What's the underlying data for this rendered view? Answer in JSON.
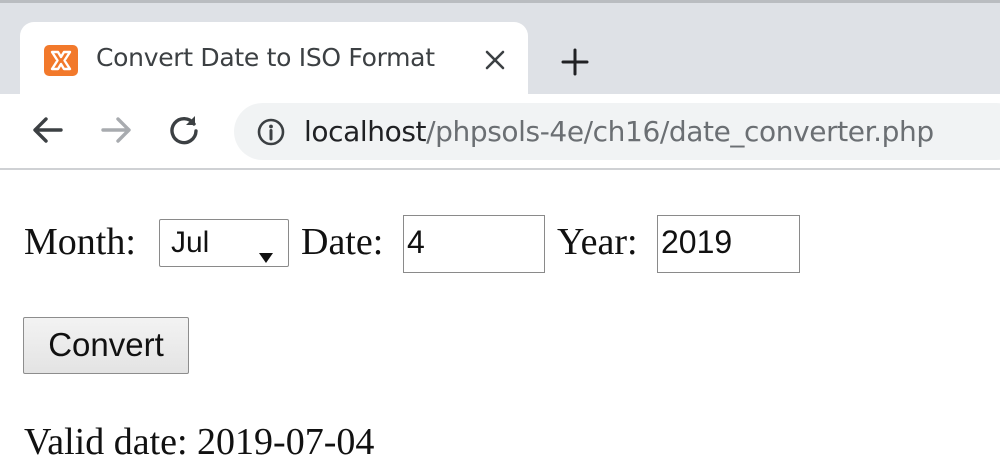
{
  "browser": {
    "tab": {
      "title": "Convert Date to ISO Format",
      "favicon": "xampp-icon"
    },
    "new_tab": "+",
    "address": {
      "host": "localhost",
      "path": "/phpsols-4e/ch16/date_converter.php"
    }
  },
  "form": {
    "month_label": "Month:",
    "month_value": "Jul",
    "date_label": "Date:",
    "date_value": "4",
    "year_label": "Year:",
    "year_value": "2019",
    "submit_label": "Convert"
  },
  "result": {
    "text": "Valid date: 2019-07-04"
  },
  "colors": {
    "tabstrip": "#dee1e6",
    "favicon": "#f2792b",
    "omnibox": "#f1f3f4"
  }
}
